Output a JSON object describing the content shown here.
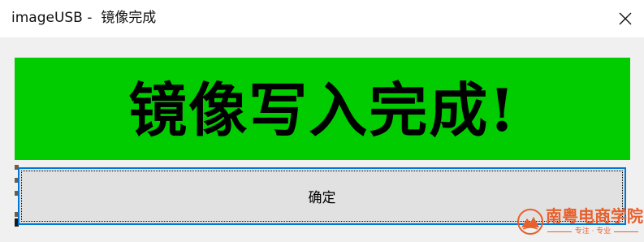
{
  "window": {
    "title": "imageUSB -  镜像完成",
    "close_icon": "close-icon"
  },
  "banner": {
    "text": "镜像写入完成!",
    "background_color": "#00cc00",
    "text_color": "#000000"
  },
  "dialog": {
    "ok_label": "确定"
  },
  "watermark": {
    "name": "南粤电商学院",
    "tagline": "专注 · 专业",
    "logo_icon": "mountain-logo-icon",
    "color": "#e8602c"
  }
}
